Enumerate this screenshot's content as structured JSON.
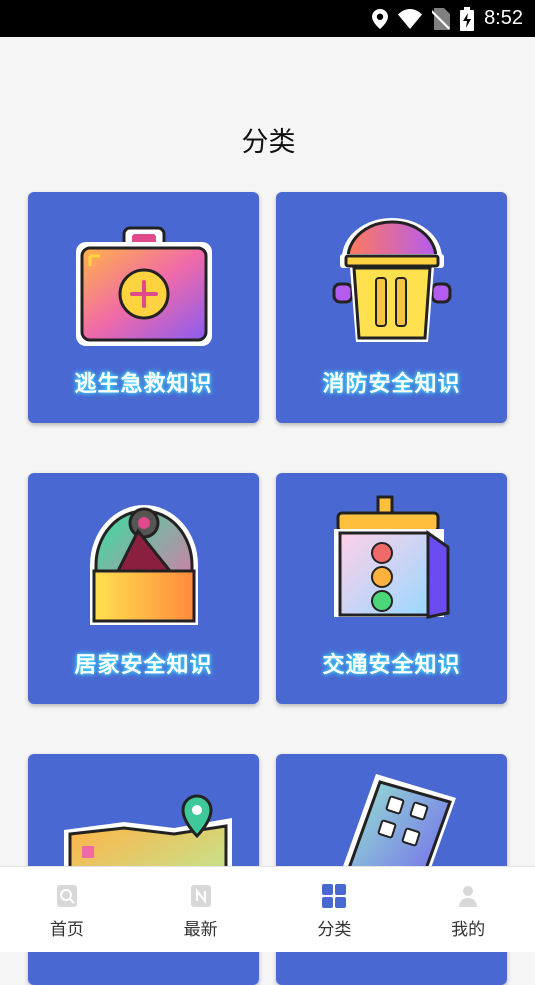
{
  "status_bar": {
    "time": "8:52",
    "icons": [
      "location-icon",
      "wifi-icon",
      "no-sim-icon",
      "battery-charging-icon"
    ]
  },
  "page": {
    "title": "分类"
  },
  "categories": [
    {
      "label": "逃生急救知识",
      "icon": "first-aid-kit-icon"
    },
    {
      "label": "消防安全知识",
      "icon": "fire-hydrant-icon"
    },
    {
      "label": "居家安全知识",
      "icon": "home-dome-icon"
    },
    {
      "label": "交通安全知识",
      "icon": "traffic-light-icon"
    },
    {
      "label": "",
      "icon": "map-pin-icon"
    },
    {
      "label": "",
      "icon": "building-icon"
    }
  ],
  "tab_bar": {
    "items": [
      {
        "label": "首页",
        "icon": "home-search-icon",
        "active": false
      },
      {
        "label": "最新",
        "icon": "news-icon",
        "active": false
      },
      {
        "label": "分类",
        "icon": "grid-icon",
        "active": true
      },
      {
        "label": "我的",
        "icon": "user-icon",
        "active": false
      }
    ]
  },
  "colors": {
    "card_bg": "#4a68d2",
    "label_glow": "#3fd8ff",
    "tab_active": "#4a68d2"
  }
}
